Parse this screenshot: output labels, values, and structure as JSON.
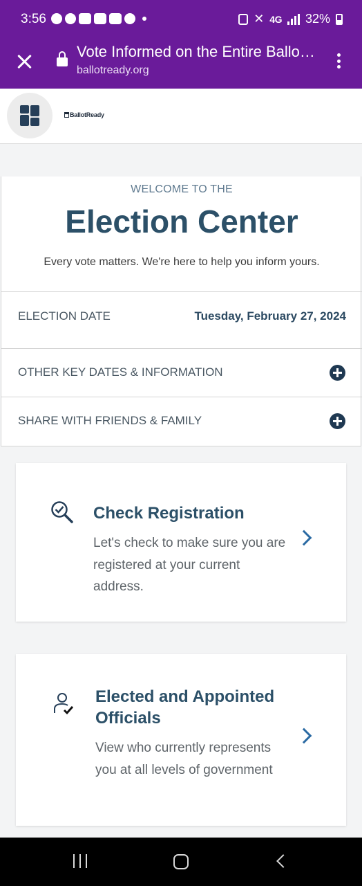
{
  "status_bar": {
    "time": "3:56",
    "network": "4G",
    "battery": "32%"
  },
  "browser": {
    "page_title": "Vote Informed on the Entire Ballot | BallotReady",
    "url": "ballotready.org",
    "accent_color": "#6a1b9a"
  },
  "site": {
    "logo_text": "BallotReady"
  },
  "election_center": {
    "welcome": "WELCOME TO THE",
    "title": "Election Center",
    "subtitle": "Every vote matters. We're here to help you inform yours.",
    "election_date_label": "ELECTION DATE",
    "election_date_value": "Tuesday, February 27, 2024",
    "key_dates_label": "OTHER KEY DATES & INFORMATION",
    "share_label": "SHARE WITH FRIENDS & FAMILY"
  },
  "cards": [
    {
      "title": "Check Registration",
      "description": "Let's check to make sure you are registered at your current address.",
      "icon": "search-check-icon"
    },
    {
      "title": "Elected and Appointed Officials",
      "description": "View who currently represents you at all levels of government",
      "icon": "person-check-icon"
    }
  ]
}
